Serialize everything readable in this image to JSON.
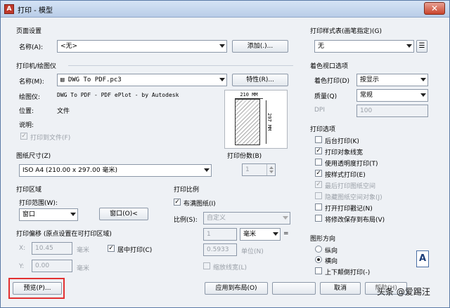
{
  "window": {
    "title": "打印 - 模型",
    "app_icon": "A",
    "close_glyph": "✕"
  },
  "page_setup": {
    "title": "页面设置",
    "name_label": "名称(A):",
    "name_value": "<无>",
    "add_button": "添加(.)..."
  },
  "printer": {
    "title": "打印机/绘图仪",
    "name_label": "名称(M):",
    "name_value": "DWG To PDF.pc3",
    "properties_button": "特性(R)...",
    "plotter_label": "绘图仪:",
    "plotter_value": "DWG To PDF - PDF ePlot - by Autodesk",
    "location_label": "位置:",
    "location_value": "文件",
    "description_label": "说明:",
    "print_to_file": "打印到文件(F)",
    "preview_width": "210 MM",
    "preview_height": "297 MM"
  },
  "paper_size": {
    "title": "图纸尺寸(Z)",
    "value": "ISO A4 (210.00 x 297.00 毫米)"
  },
  "copies": {
    "title": "打印份数(B)",
    "value": "1"
  },
  "plot_area": {
    "title": "打印区域",
    "range_label": "打印范围(W):",
    "range_value": "窗口",
    "window_button": "窗口(O)<"
  },
  "plot_offset": {
    "title": "打印偏移 (原点设置在可打印区域)",
    "x_label": "X:",
    "x_value": "10.45",
    "x_unit": "毫米",
    "y_label": "Y:",
    "y_value": "0.00",
    "y_unit": "毫米",
    "center_label": "居中打印(C)"
  },
  "plot_scale": {
    "title": "打印比例",
    "fit_label": "布满图纸(I)",
    "scale_label": "比例(S):",
    "scale_value": "自定义",
    "value1": "1",
    "unit1": "毫米",
    "equals": "=",
    "value2": "0.5933",
    "unit2": "单位(N)",
    "lineweights": "缩放线宽(L)"
  },
  "plot_style_table": {
    "title": "打印样式表(画笔指定)(G)",
    "value": "无"
  },
  "shaded_viewport": {
    "title": "着色视口选项",
    "shade_label": "着色打印(D)",
    "shade_value": "按显示",
    "quality_label": "质量(Q)",
    "quality_value": "常规",
    "dpi_label": "DPI",
    "dpi_value": "100"
  },
  "plot_options": {
    "title": "打印选项",
    "items": [
      {
        "label": "后台打印(K)",
        "checked": false,
        "disabled": false
      },
      {
        "label": "打印对象线宽",
        "checked": true,
        "disabled": false
      },
      {
        "label": "使用透明度打印(T)",
        "checked": false,
        "disabled": false
      },
      {
        "label": "按样式打印(E)",
        "checked": true,
        "disabled": false
      },
      {
        "label": "最后打印图纸空间",
        "checked": true,
        "disabled": true
      },
      {
        "label": "隐藏图纸空间对象(J)",
        "checked": false,
        "disabled": true
      },
      {
        "label": "打开打印戳记(N)",
        "checked": false,
        "disabled": false
      },
      {
        "label": "将修改保存到布局(V)",
        "checked": false,
        "disabled": false
      }
    ]
  },
  "orientation": {
    "title": "图形方向",
    "portrait": "纵向",
    "landscape": "横向",
    "upside_down": "上下颠倒打印(-)",
    "icon_glyph": "A"
  },
  "footer": {
    "preview_button": "预览(P)...",
    "apply_button": "应用到布局(O)",
    "cancel_button": "取消",
    "help_button": "帮助(H)"
  },
  "watermark": "头条 @爱踢汪",
  "colors": {
    "highlight": "#e23030"
  }
}
